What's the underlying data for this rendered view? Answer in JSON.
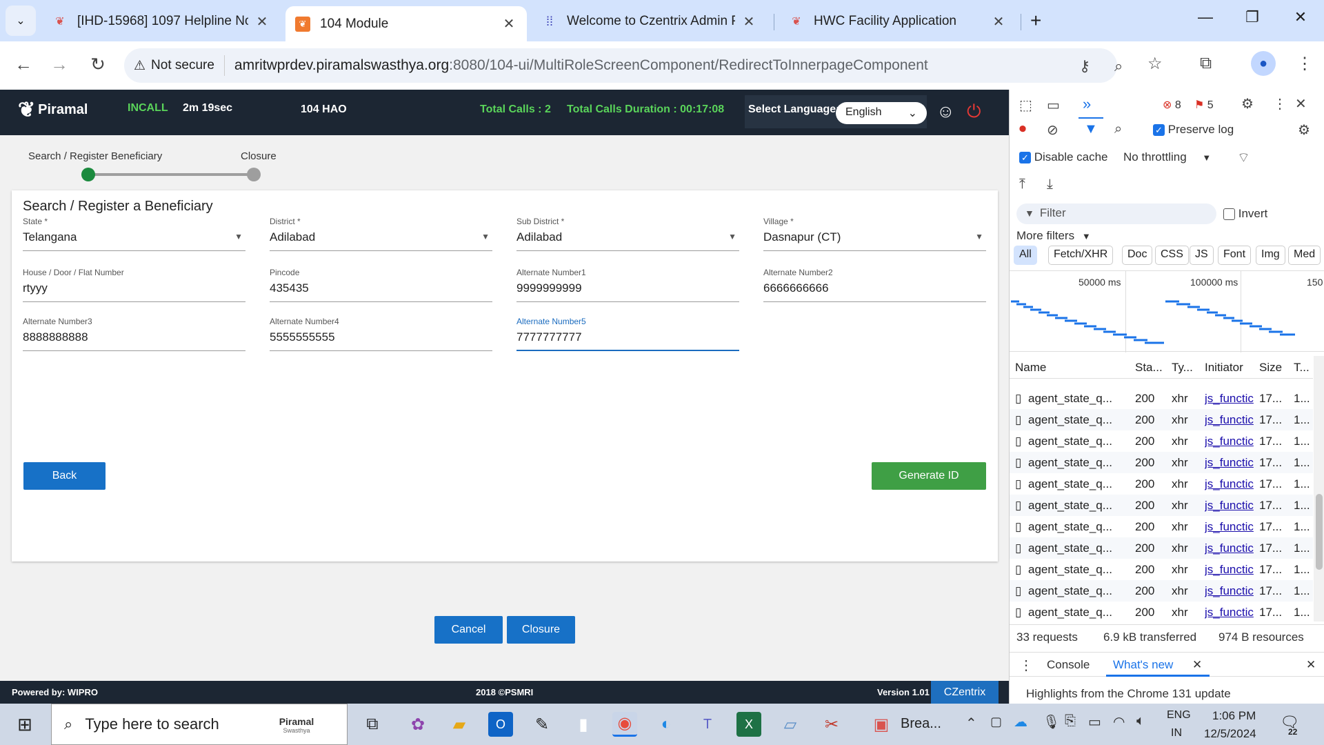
{
  "browser": {
    "tabs": [
      {
        "title": "[IHD-15968] 1097 Helpline No",
        "icon": "piramal-flame-icon"
      },
      {
        "title": "104 Module",
        "icon": "piramal-tab-icon"
      },
      {
        "title": "Welcome to Czentrix Admin Par",
        "icon": "dots-grid-icon"
      },
      {
        "title": "HWC Facility Application",
        "icon": "piramal-flame-icon"
      }
    ],
    "security": "Not secure",
    "url_host": "amritwprdev.piramalswasthya.org",
    "url_path": ":8080/104-ui/MultiRoleScreenComponent/RedirectToInnerpageComponent"
  },
  "header": {
    "logo": "Piramal",
    "call_state": "INCALL",
    "call_timer": "2m 19sec",
    "role": "104 HAO",
    "total_calls": "Total Calls : 2",
    "total_duration": "Total Calls Duration : 00:17:08",
    "language_label": "Select Language:",
    "language_value": "English"
  },
  "stepper": {
    "step1": "Search / Register Beneficiary",
    "step2": "Closure"
  },
  "form": {
    "title": "Search / Register a Beneficiary",
    "fields": [
      {
        "label": "State *",
        "value": "Telangana"
      },
      {
        "label": "District *",
        "value": "Adilabad"
      },
      {
        "label": "Sub District *",
        "value": "Adilabad"
      },
      {
        "label": "Village *",
        "value": "Dasnapur (CT)"
      },
      {
        "label": "House / Door / Flat Number",
        "value": "rtyyy"
      },
      {
        "label": "Pincode",
        "value": "435435"
      },
      {
        "label": "Alternate Number1",
        "value": "9999999999"
      },
      {
        "label": "Alternate Number2",
        "value": "6666666666"
      },
      {
        "label": "Alternate Number3",
        "value": "8888888888"
      },
      {
        "label": "Alternate Number4",
        "value": "5555555555"
      },
      {
        "label": "Alternate Number5",
        "value": "7777777777"
      }
    ],
    "back": "Back",
    "generate": "Generate ID",
    "cancel": "Cancel",
    "closure": "Closure"
  },
  "footer": {
    "powered": "Powered by: WIPRO",
    "copyright": "2018 ©PSMRI",
    "version": "Version 1.01",
    "brand": "CZentrix"
  },
  "devtools": {
    "errors": "8",
    "warnings": "5",
    "preserve_log": "Preserve log",
    "disable_cache": "Disable cache",
    "throttling": "No throttling",
    "filter_placeholder": "Filter",
    "invert": "Invert",
    "more_filters": "More filters",
    "chips": [
      "All",
      "Fetch/XHR",
      "Doc",
      "CSS",
      "JS",
      "Font",
      "Img",
      "Med"
    ],
    "timeline_ticks": [
      "50000 ms",
      "100000 ms",
      "150"
    ],
    "columns": [
      "Name",
      "Sta...",
      "Ty...",
      "Initiator",
      "Size",
      "T..."
    ],
    "rows": [
      {
        "name": "agent_state_q...",
        "status": "200",
        "type": "xhr",
        "initiator": "js_functic",
        "size": "17...",
        "time": "1..."
      },
      {
        "name": "agent_state_q...",
        "status": "200",
        "type": "xhr",
        "initiator": "js_functic",
        "size": "17...",
        "time": "1..."
      },
      {
        "name": "agent_state_q...",
        "status": "200",
        "type": "xhr",
        "initiator": "js_functic",
        "size": "17...",
        "time": "1..."
      },
      {
        "name": "agent_state_q...",
        "status": "200",
        "type": "xhr",
        "initiator": "js_functic",
        "size": "17...",
        "time": "1..."
      },
      {
        "name": "agent_state_q...",
        "status": "200",
        "type": "xhr",
        "initiator": "js_functic",
        "size": "17...",
        "time": "1..."
      },
      {
        "name": "agent_state_q...",
        "status": "200",
        "type": "xhr",
        "initiator": "js_functic",
        "size": "17...",
        "time": "1..."
      },
      {
        "name": "agent_state_q...",
        "status": "200",
        "type": "xhr",
        "initiator": "js_functic",
        "size": "17...",
        "time": "1..."
      },
      {
        "name": "agent_state_q...",
        "status": "200",
        "type": "xhr",
        "initiator": "js_functic",
        "size": "17...",
        "time": "1..."
      },
      {
        "name": "agent_state_q...",
        "status": "200",
        "type": "xhr",
        "initiator": "js_functic",
        "size": "17...",
        "time": "1..."
      },
      {
        "name": "agent_state_q...",
        "status": "200",
        "type": "xhr",
        "initiator": "js_functic",
        "size": "17...",
        "time": "1..."
      },
      {
        "name": "agent_state_q...",
        "status": "200",
        "type": "xhr",
        "initiator": "js_functic",
        "size": "17...",
        "time": "1..."
      }
    ],
    "requests": "33 requests",
    "transferred": "6.9 kB transferred",
    "resources": "974 B resources",
    "drawer_console": "Console",
    "drawer_whatsnew": "What's new",
    "highlights": "Highlights from the Chrome 131 update"
  },
  "taskbar": {
    "search_placeholder": "Type here to search",
    "search_brand": "Piramal",
    "search_brand_sub": "Swasthya",
    "app_label": "Brea...",
    "lang1": "ENG",
    "lang2": "IN",
    "time": "1:06 PM",
    "date": "12/5/2024",
    "notifications": "22"
  }
}
